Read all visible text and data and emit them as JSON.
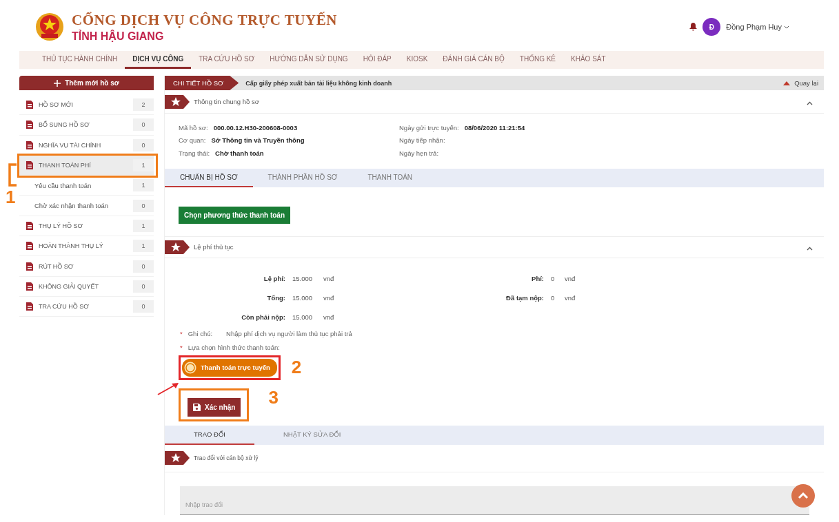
{
  "header": {
    "title": "CỔNG DỊCH VỤ CÔNG TRỰC TUYẾN",
    "subtitle": "TỈNH HẬU GIANG",
    "user": {
      "initial": "Đ",
      "name": "Đồng Phạm Huy"
    }
  },
  "nav": [
    {
      "label": "THỦ TỤC HÀNH CHÍNH",
      "selected": false
    },
    {
      "label": "DỊCH VỤ CÔNG",
      "selected": true
    },
    {
      "label": "TRA CỨU HỒ SƠ",
      "selected": false
    },
    {
      "label": "HƯỚNG DẪN SỬ DỤNG",
      "selected": false
    },
    {
      "label": "HỎI ĐÁP",
      "selected": false
    },
    {
      "label": "KIOSK",
      "selected": false
    },
    {
      "label": "ĐÁNH GIÁ CÁN BỘ",
      "selected": false
    },
    {
      "label": "THỐNG KÊ",
      "selected": false
    },
    {
      "label": "KHẢO SÁT",
      "selected": false
    }
  ],
  "sidebar": {
    "add_button": "Thêm mới hồ sơ",
    "items": [
      {
        "label": "HỒ SƠ MỚI",
        "count": "2",
        "selected": false
      },
      {
        "label": "BỔ SUNG HỒ SƠ",
        "count": "0",
        "selected": false
      },
      {
        "label": "NGHĨA VỤ TÀI CHÍNH",
        "count": "0",
        "selected": false
      },
      {
        "label": "THANH TOÁN PHÍ",
        "count": "1",
        "selected": true,
        "children": [
          {
            "label": "Yêu cầu thanh toán",
            "count": "1",
            "selected": false
          },
          {
            "label": "Chờ xác nhận thanh toán",
            "count": "0",
            "selected": false
          }
        ]
      },
      {
        "label": "THỤ LÝ HỒ SƠ",
        "count": "1",
        "selected": false
      },
      {
        "label": "HOÀN THÀNH THỤ LÝ",
        "count": "1",
        "selected": false
      },
      {
        "label": "RÚT HỒ SƠ",
        "count": "0",
        "selected": false
      },
      {
        "label": "KHÔNG GIẢI QUYẾT",
        "count": "0",
        "selected": false
      },
      {
        "label": "TRA CỨU HỒ SƠ",
        "count": "0",
        "selected": false
      }
    ]
  },
  "breadcrumb": {
    "section": "CHI TIẾT HỒ SƠ",
    "title": "Cấp giấy phép xuất bản tài liệu không kinh doanh",
    "back": "Quay lại"
  },
  "general_info": {
    "title": "Thông tin chung hồ sơ",
    "expanded": true,
    "left": [
      {
        "label": "Mã hồ sơ:",
        "value": "000.00.12.H30-200608-0003"
      },
      {
        "label": "Cơ quan:",
        "value": "Sở Thông tin và Truyền thông"
      },
      {
        "label": "Trạng thái:",
        "value": "Chờ thanh toán"
      }
    ],
    "right": [
      {
        "label": "Ngày gửi trực tuyến:",
        "value": "08/06/2020 11:21:54"
      },
      {
        "label": "Ngày tiếp nhận:"
      },
      {
        "label": "Ngày hẹn trả:"
      }
    ]
  },
  "tabs": [
    {
      "label": "CHUẨN BỊ HỒ SƠ",
      "selected": true
    },
    {
      "label": "THÀNH PHẦN HỒ SƠ",
      "selected": false
    },
    {
      "label": "THANH TOÁN",
      "selected": false
    }
  ],
  "choose_button": "Chọn phương thức thanh toán",
  "fees": {
    "title": "Lệ phí thủ tục",
    "expanded": true,
    "left": [
      {
        "label": "Lệ phí:",
        "amount": "15.000",
        "unit": "vnđ"
      },
      {
        "label": "Tổng:",
        "amount": "15.000",
        "unit": "vnđ"
      },
      {
        "label": "Còn phải nộp:",
        "amount": "15.000",
        "unit": "vnđ"
      }
    ],
    "right": [
      {
        "label": "Phí:",
        "amount": "0",
        "unit": "vnđ"
      },
      {
        "label": "Đã tạm nộp:",
        "amount": "0",
        "unit": "vnđ"
      }
    ],
    "note_mark": "*",
    "method_mark": "*",
    "note_label": "Ghi chú:",
    "note": "Nhập phí dịch vụ người làm thủ tục phải trả",
    "method_label": "Lựa chọn hình thức thanh toán:",
    "pay_button": "Thanh toán trực tuyến",
    "confirm_button": "Xác nhận"
  },
  "bottom_tabs": [
    {
      "label": "TRAO ĐỔI",
      "selected": true
    },
    {
      "label": "NHẬT KÝ SỬA ĐỔI",
      "selected": false
    }
  ],
  "exchange": {
    "title": "Trao đổi với cán bộ xử lý",
    "placeholder": "Nhập trao đổi"
  },
  "annotations": [
    "1",
    "2",
    "3"
  ]
}
